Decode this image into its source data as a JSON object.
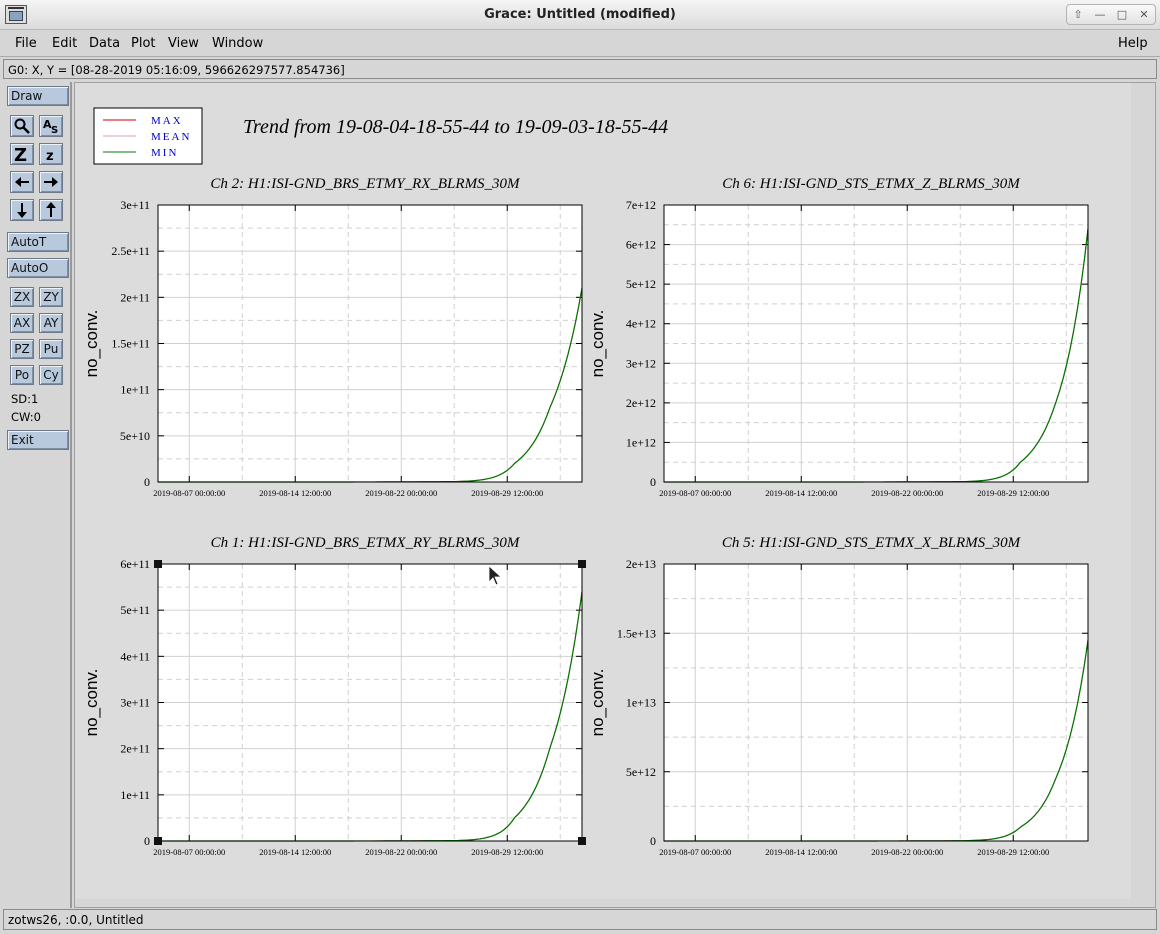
{
  "window": {
    "title": "Grace: Untitled (modified)",
    "controls": [
      "⇧",
      "—",
      "□",
      "✕"
    ]
  },
  "menu": {
    "items": [
      "File",
      "Edit",
      "Data",
      "Plot",
      "View",
      "Window"
    ],
    "help": "Help"
  },
  "locator": {
    "text": "G0: X, Y = [08-28-2019 05:16:09, 596626297577.854736]"
  },
  "toolbar": {
    "draw": "Draw",
    "auto_t": "AutoT",
    "auto_o": "AutoO",
    "zx": "ZX",
    "zy": "ZY",
    "ax": "AX",
    "ay": "AY",
    "pz": "PZ",
    "pu": "Pu",
    "po": "Po",
    "cy": "Cy",
    "sd": "SD:1",
    "cw": "CW:0",
    "exit": "Exit"
  },
  "status": {
    "text": "zotws26, :0.0, Untitled"
  },
  "colors": {
    "max": "#cc0000",
    "mean": "#d9a0c0",
    "min": "#007700",
    "legend_text": "#0000cc"
  },
  "figure": {
    "title": "Trend from 19-08-04-18-55-44 to 19-09-03-18-55-44",
    "legend": [
      "MAX",
      "MEAN",
      "MIN"
    ]
  },
  "chart_data": [
    {
      "type": "line",
      "title": "Ch 2: H1:ISI-GND_BRS_ETMY_RX_BLRMS_30M",
      "xlabel": "",
      "ylabel": "no_conv.",
      "x_ticks": [
        "2019-08-07 00:00:00",
        "2019-08-14 12:00:00",
        "2019-08-22 00:00:00",
        "2019-08-29 12:00:00"
      ],
      "y_ticks": [
        "0",
        "5e+10",
        "1e+11",
        "1.5e+11",
        "2e+11",
        "2.5e+11",
        "3e+11"
      ],
      "ylim": [
        0,
        300000000000
      ],
      "xlim": [
        "2019-08-04 18:55:44",
        "2019-09-03 18:55:44"
      ],
      "series": [
        {
          "name": "MAX",
          "x": [
            "2019-08-04 18:55:44",
            "2019-08-26 00:00:00",
            "2019-08-30 00:00:00",
            "2019-09-01 12:00:00",
            "2019-09-03 18:55:44"
          ],
          "values": [
            0,
            500000000,
            20000000000,
            80000000000,
            210000000000
          ]
        },
        {
          "name": "MEAN",
          "x": [
            "2019-08-04 18:55:44",
            "2019-08-26 00:00:00",
            "2019-08-30 00:00:00",
            "2019-09-01 12:00:00",
            "2019-09-03 18:55:44"
          ],
          "values": [
            0,
            500000000,
            20000000000,
            80000000000,
            210000000000
          ]
        },
        {
          "name": "MIN",
          "x": [
            "2019-08-04 18:55:44",
            "2019-08-26 00:00:00",
            "2019-08-30 00:00:00",
            "2019-09-01 12:00:00",
            "2019-09-03 18:55:44"
          ],
          "values": [
            0,
            500000000,
            20000000000,
            80000000000,
            210000000000
          ]
        }
      ],
      "grid": true,
      "legend": "figure-top-left"
    },
    {
      "type": "line",
      "title": "Ch 6: H1:ISI-GND_STS_ETMX_Z_BLRMS_30M",
      "xlabel": "",
      "ylabel": "no_conv.",
      "x_ticks": [
        "2019-08-07 00:00:00",
        "2019-08-14 12:00:00",
        "2019-08-22 00:00:00",
        "2019-08-29 12:00:00"
      ],
      "y_ticks": [
        "0",
        "1e+12",
        "2e+12",
        "3e+12",
        "4e+12",
        "5e+12",
        "6e+12",
        "7e+12"
      ],
      "ylim": [
        0,
        7000000000000
      ],
      "xlim": [
        "2019-08-04 18:55:44",
        "2019-09-03 18:55:44"
      ],
      "series": [
        {
          "name": "MAX",
          "x": [
            "2019-08-04 18:55:44",
            "2019-08-26 00:00:00",
            "2019-08-30 00:00:00",
            "2019-09-01 12:00:00",
            "2019-09-03 18:55:44"
          ],
          "values": [
            0,
            10000000000,
            500000000000,
            2000000000000,
            6400000000000
          ]
        },
        {
          "name": "MEAN",
          "x": [
            "2019-08-04 18:55:44",
            "2019-08-26 00:00:00",
            "2019-08-30 00:00:00",
            "2019-09-01 12:00:00",
            "2019-09-03 18:55:44"
          ],
          "values": [
            0,
            10000000000,
            500000000000,
            2000000000000,
            6400000000000
          ]
        },
        {
          "name": "MIN",
          "x": [
            "2019-08-04 18:55:44",
            "2019-08-26 00:00:00",
            "2019-08-30 00:00:00",
            "2019-09-01 12:00:00",
            "2019-09-03 18:55:44"
          ],
          "values": [
            0,
            10000000000,
            500000000000,
            2000000000000,
            6400000000000
          ]
        }
      ],
      "grid": true
    },
    {
      "type": "line",
      "title": "Ch 1: H1:ISI-GND_BRS_ETMX_RY_BLRMS_30M",
      "xlabel": "",
      "ylabel": "no_conv.",
      "x_ticks": [
        "2019-08-07 00:00:00",
        "2019-08-14 12:00:00",
        "2019-08-22 00:00:00",
        "2019-08-29 12:00:00"
      ],
      "y_ticks": [
        "0",
        "1e+11",
        "2e+11",
        "3e+11",
        "4e+11",
        "5e+11",
        "6e+11"
      ],
      "ylim": [
        0,
        600000000000
      ],
      "xlim": [
        "2019-08-04 18:55:44",
        "2019-09-03 18:55:44"
      ],
      "series": [
        {
          "name": "MAX",
          "x": [
            "2019-08-04 18:55:44",
            "2019-08-26 00:00:00",
            "2019-08-30 00:00:00",
            "2019-09-01 12:00:00",
            "2019-09-03 18:55:44"
          ],
          "values": [
            0,
            1000000000,
            50000000000,
            200000000000,
            540000000000
          ]
        },
        {
          "name": "MEAN",
          "x": [
            "2019-08-04 18:55:44",
            "2019-08-26 00:00:00",
            "2019-08-30 00:00:00",
            "2019-09-01 12:00:00",
            "2019-09-03 18:55:44"
          ],
          "values": [
            0,
            1000000000,
            50000000000,
            200000000000,
            540000000000
          ]
        },
        {
          "name": "MIN",
          "x": [
            "2019-08-04 18:55:44",
            "2019-08-26 00:00:00",
            "2019-08-30 00:00:00",
            "2019-09-01 12:00:00",
            "2019-09-03 18:55:44"
          ],
          "values": [
            0,
            1000000000,
            50000000000,
            200000000000,
            540000000000
          ]
        }
      ],
      "grid": true,
      "selected": true
    },
    {
      "type": "line",
      "title": "Ch 5: H1:ISI-GND_STS_ETMX_X_BLRMS_30M",
      "xlabel": "",
      "ylabel": "no_conv.",
      "x_ticks": [
        "2019-08-07 00:00:00",
        "2019-08-14 12:00:00",
        "2019-08-22 00:00:00",
        "2019-08-29 12:00:00"
      ],
      "y_ticks": [
        "0",
        "5e+12",
        "1e+13",
        "1.5e+13",
        "2e+13"
      ],
      "ylim": [
        0,
        20000000000000
      ],
      "xlim": [
        "2019-08-04 18:55:44",
        "2019-09-03 18:55:44"
      ],
      "series": [
        {
          "name": "MAX",
          "x": [
            "2019-08-04 18:55:44",
            "2019-08-26 00:00:00",
            "2019-08-30 00:00:00",
            "2019-09-01 12:00:00",
            "2019-09-03 18:55:44"
          ],
          "values": [
            0,
            20000000000,
            1000000000000,
            4500000000000,
            14500000000000
          ]
        },
        {
          "name": "MEAN",
          "x": [
            "2019-08-04 18:55:44",
            "2019-08-26 00:00:00",
            "2019-08-30 00:00:00",
            "2019-09-01 12:00:00",
            "2019-09-03 18:55:44"
          ],
          "values": [
            0,
            20000000000,
            1000000000000,
            4500000000000,
            14500000000000
          ]
        },
        {
          "name": "MIN",
          "x": [
            "2019-08-04 18:55:44",
            "2019-08-26 00:00:00",
            "2019-08-30 00:00:00",
            "2019-09-01 12:00:00",
            "2019-09-03 18:55:44"
          ],
          "values": [
            0,
            20000000000,
            1000000000000,
            4500000000000,
            14500000000000
          ]
        }
      ],
      "grid": true
    }
  ]
}
